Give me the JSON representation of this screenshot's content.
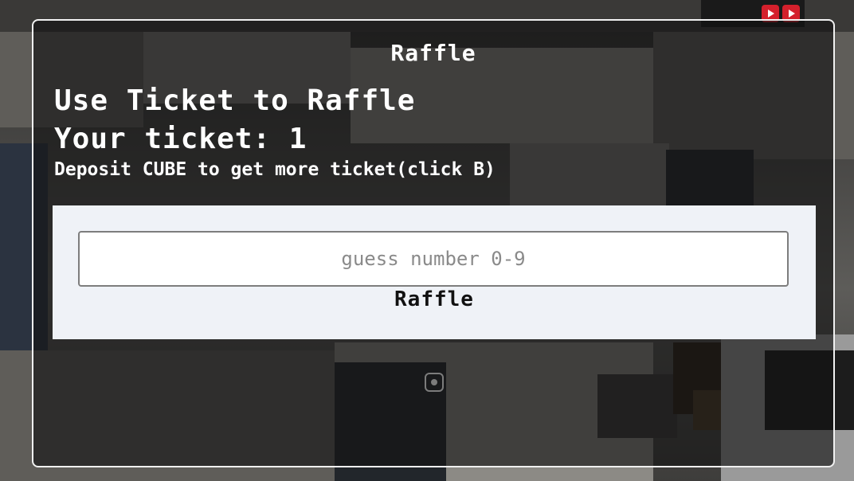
{
  "modal": {
    "title": "Raffle",
    "headline": "Use Ticket to Raffle",
    "ticket_label": "Your ticket:",
    "ticket_count": "1",
    "instruction": "Deposit CUBE to get more ticket(click B)"
  },
  "form": {
    "guess_placeholder": "guess number 0-9",
    "guess_value": "",
    "raffle_button_label": "Raffle"
  },
  "icons": {
    "scene_logo": "youtube-logo-icon",
    "bottom_icon": "record-icon"
  },
  "colors": {
    "modal_border": "#f1f1f1",
    "form_panel_bg": "#eff2f7",
    "text_primary": "#ffffff",
    "logo_red": "#d4202c"
  }
}
